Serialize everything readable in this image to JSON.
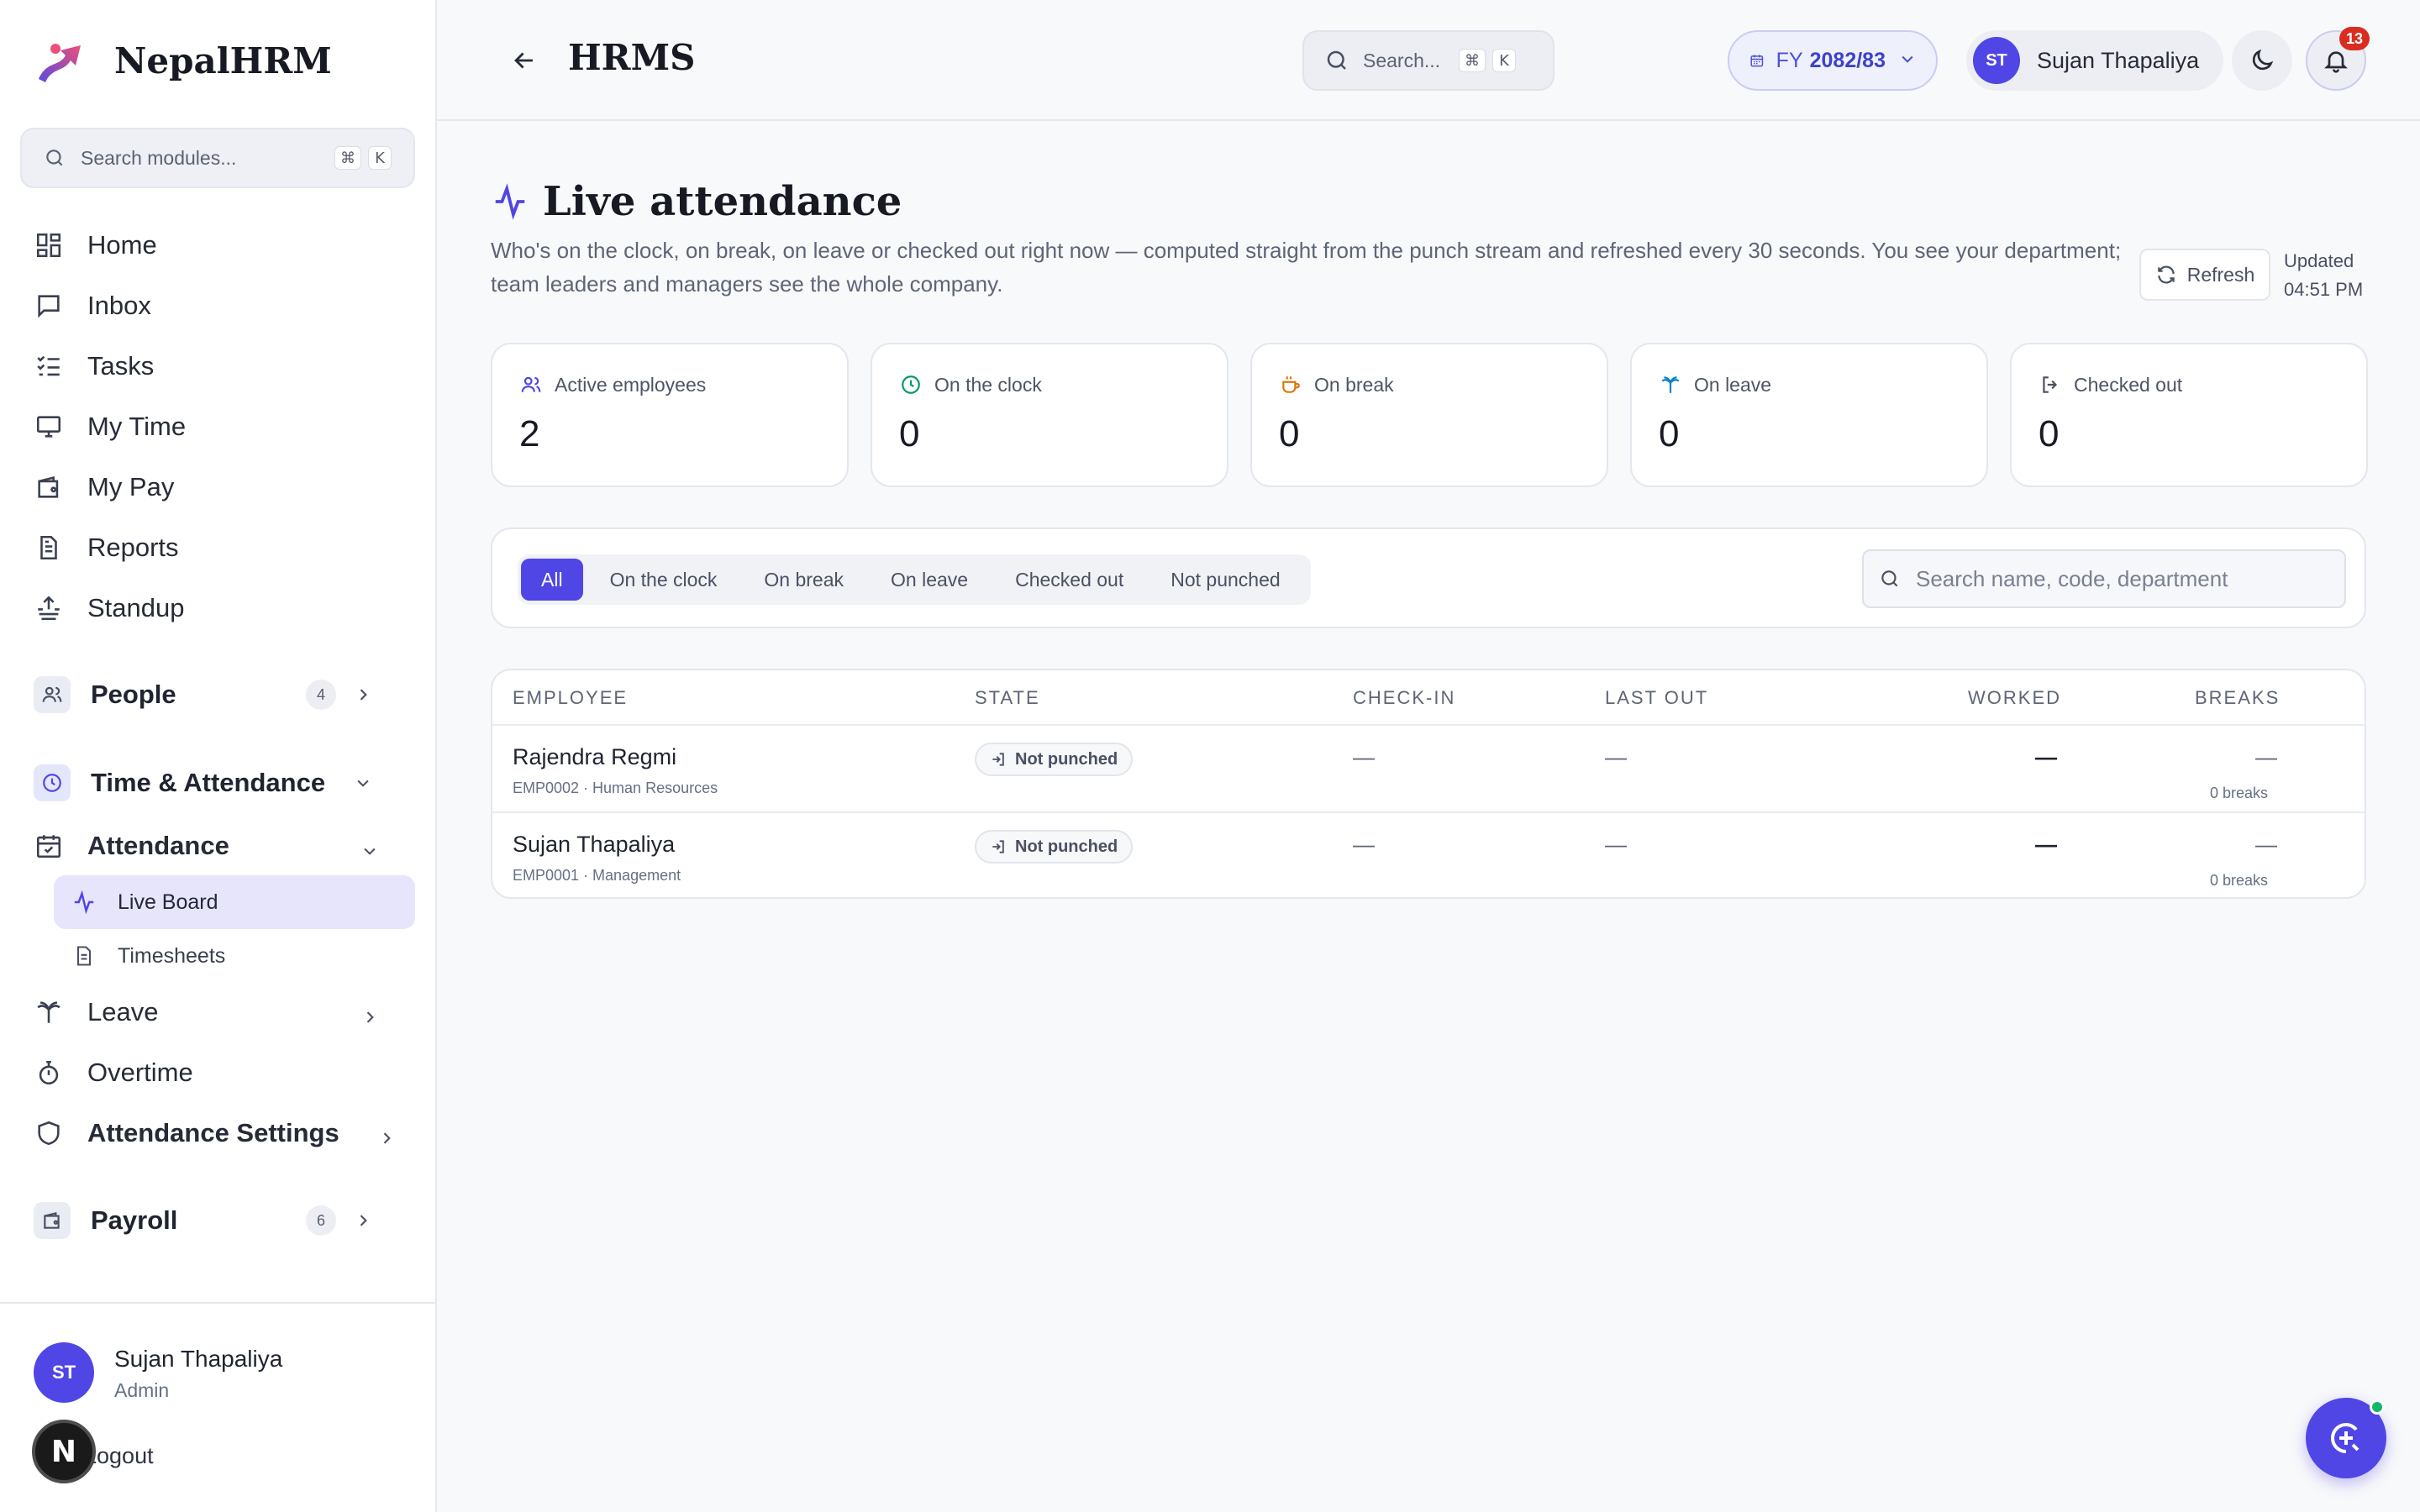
{
  "brand": {
    "name": "NepalHRM"
  },
  "sidebar": {
    "search": {
      "placeholder": "Search modules...",
      "kbd_mod": "⌘",
      "kbd_key": "K"
    },
    "items": [
      {
        "label": "Home",
        "icon": "grid-icon"
      },
      {
        "label": "Inbox",
        "icon": "message-icon"
      },
      {
        "label": "Tasks",
        "icon": "checklist-icon"
      },
      {
        "label": "My Time",
        "icon": "monitor-icon"
      },
      {
        "label": "My Pay",
        "icon": "wallet-icon"
      },
      {
        "label": "Reports",
        "icon": "document-icon"
      },
      {
        "label": "Standup",
        "icon": "standup-icon"
      }
    ],
    "people": {
      "label": "People",
      "count": "4"
    },
    "time_attendance": {
      "label": "Time & Attendance"
    },
    "attendance": {
      "label": "Attendance"
    },
    "live_board": {
      "label": "Live Board"
    },
    "timesheets": {
      "label": "Timesheets"
    },
    "leave": {
      "label": "Leave"
    },
    "overtime": {
      "label": "Overtime"
    },
    "attendance_settings": {
      "label": "Attendance Settings"
    },
    "payroll": {
      "label": "Payroll",
      "count": "6"
    },
    "footer": {
      "initials": "ST",
      "name": "Sujan Thapaliya",
      "role": "Admin",
      "logout": "Logout",
      "badge": "N"
    }
  },
  "topbar": {
    "title": "HRMS",
    "search": {
      "placeholder": "Search...",
      "kbd_mod": "⌘",
      "kbd_key": "K"
    },
    "fy": {
      "label": "FY",
      "value": "2082/83"
    },
    "user": {
      "initials": "ST",
      "name": "Sujan Thapaliya"
    },
    "notifications": "13"
  },
  "page": {
    "title": "Live attendance",
    "description": "Who's on the clock, on break, on leave or checked out right now — computed straight from the punch stream and refreshed every 30 seconds. You see your department; team leaders and managers see the whole company.",
    "refresh_label": "Refresh",
    "updated_label": "Updated",
    "updated_time": "04:51 PM"
  },
  "stats": [
    {
      "label": "Active employees",
      "value": "2",
      "icon": "users-icon",
      "color": "#4f46e5"
    },
    {
      "label": "On the clock",
      "value": "0",
      "icon": "clock-icon",
      "color": "#059669"
    },
    {
      "label": "On break",
      "value": "0",
      "icon": "coffee-icon",
      "color": "#d97706"
    },
    {
      "label": "On leave",
      "value": "0",
      "icon": "palm-tree-icon",
      "color": "#0284c7"
    },
    {
      "label": "Checked out",
      "value": "0",
      "icon": "logout-icon",
      "color": "#4a5063"
    }
  ],
  "filters": {
    "tabs": [
      "All",
      "On the clock",
      "On break",
      "On leave",
      "Checked out",
      "Not punched"
    ],
    "active": "All",
    "search_placeholder": "Search name, code, department"
  },
  "table": {
    "columns": [
      "EMPLOYEE",
      "STATE",
      "CHECK-IN",
      "LAST OUT",
      "WORKED",
      "BREAKS"
    ],
    "rows": [
      {
        "name": "Rajendra Regmi",
        "sub": "EMP0002 · Human Resources",
        "state": "Not punched",
        "check_in": "—",
        "last_out": "—",
        "worked": "—",
        "breaks": "—",
        "breaks_sub": "0 breaks"
      },
      {
        "name": "Sujan Thapaliya",
        "sub": "EMP0001 · Management",
        "state": "Not punched",
        "check_in": "—",
        "last_out": "—",
        "worked": "—",
        "breaks": "—",
        "breaks_sub": "0 breaks"
      }
    ]
  },
  "colors": {
    "accent": "#4f46e5",
    "danger": "#d92d20",
    "online": "#12b76a"
  }
}
